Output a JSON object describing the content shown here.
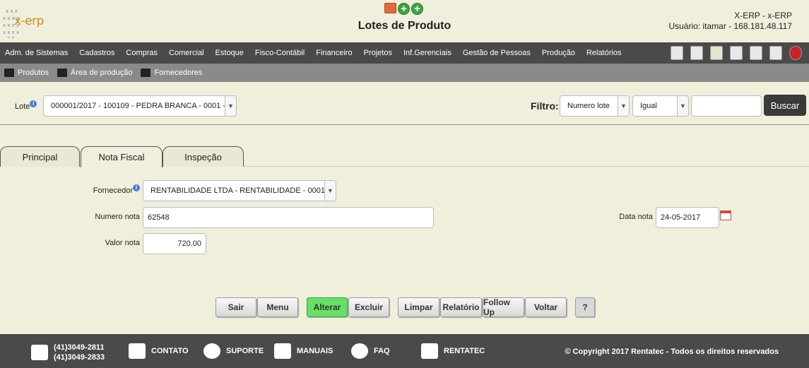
{
  "header": {
    "logo_text": "x-erp",
    "title": "Lotes de Produto",
    "user_line1": "X-ERP - x-ERP",
    "user_line2": "Usuário: itamar - 168.181.48.117"
  },
  "menu": {
    "items": [
      "Adm. de Sistemas",
      "Cadastros",
      "Compras",
      "Comercial",
      "Estoque",
      "Fisco-Contábil",
      "Financeiro",
      "Projetos",
      "Inf.Gerenciais",
      "Gestão de Pessoas",
      "Produção",
      "Relatórios"
    ],
    "icons": [
      "home-icon",
      "printer-icon",
      "shield-icon",
      "document-icon",
      "list-icon",
      "chat-icon",
      "power-icon"
    ]
  },
  "submenu": {
    "items": [
      {
        "label": "Produtos",
        "icon": "cart-icon"
      },
      {
        "label": "Área de produção",
        "icon": "factory-icon"
      },
      {
        "label": "Fornecedores",
        "icon": "truck-icon"
      }
    ]
  },
  "lote": {
    "label": "Lote",
    "value": "000001/2017 - 100109 - PEDRA BRANCA - 0001 -"
  },
  "filtro": {
    "label": "Filtro:",
    "field": "Numero lote",
    "operator": "Igual",
    "value": "",
    "button": "Buscar"
  },
  "tabs": [
    {
      "label": "Principal",
      "active": false
    },
    {
      "label": "Nota Fiscal",
      "active": true
    },
    {
      "label": "Inspeção",
      "active": false
    }
  ],
  "form": {
    "fornecedor_label": "Fornecedor",
    "fornecedor_value": "RENTABILIDADE LTDA - RENTABILIDADE - 0001 - -",
    "numero_nota_label": "Numero nota",
    "numero_nota_value": "62548",
    "data_nota_label": "Data nota",
    "data_nota_value": "24-05-2017",
    "valor_nota_label": "Valor nota",
    "valor_nota_value": "720.00"
  },
  "actions": {
    "sair": "Sair",
    "menu": "Menu",
    "alterar": "Alterar",
    "excluir": "Excluir",
    "limpar": "Limpar",
    "relatorio": "Relatório",
    "follow_up": "Follow Up",
    "voltar": "Voltar",
    "help": "?"
  },
  "footer": {
    "phone1": "(41)3049-2811",
    "phone2": "(41)3049-2833",
    "contato": "CONTATO",
    "suporte": "SUPORTE",
    "manuais": "MANUAIS",
    "faq": "FAQ",
    "rentatec": "RENTATEC",
    "copyright": "© Copyright 2017 Rentatec - Todos os direitos reservados"
  },
  "colors": {
    "background": "#f0efdc",
    "menubar": "#4a4a4a",
    "submenu": "#8a8a8a",
    "alterar": "#66e066"
  }
}
